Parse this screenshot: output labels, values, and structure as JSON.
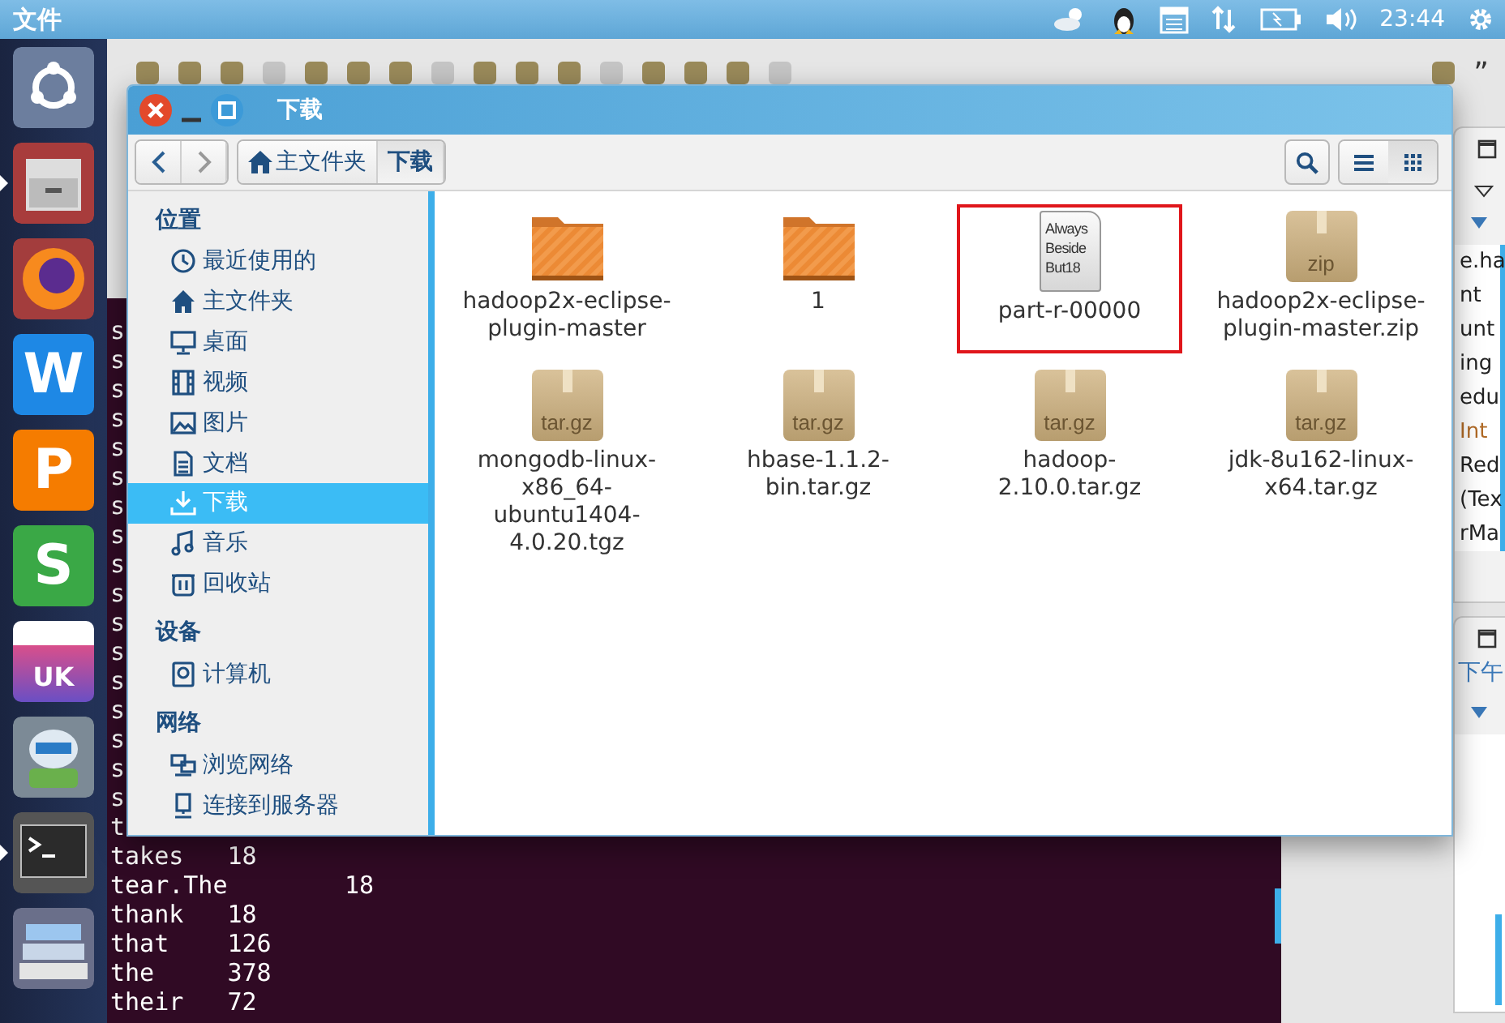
{
  "top_panel": {
    "menu": "文件",
    "clock": "23:44"
  },
  "launcher": [
    {
      "kind": "ubuntu",
      "selected": false
    },
    {
      "kind": "drawer",
      "selected": true
    },
    {
      "kind": "firefox",
      "selected": false
    },
    {
      "kind": "letter",
      "glyph": "W",
      "color": "#1e88e5",
      "selected": false
    },
    {
      "kind": "letter",
      "glyph": "P",
      "color": "#f57c00",
      "selected": false
    },
    {
      "kind": "letter",
      "glyph": "S",
      "color": "#3aa846",
      "selected": false
    },
    {
      "kind": "store",
      "glyph": "UK",
      "selected": false
    },
    {
      "kind": "robot",
      "selected": false
    },
    {
      "kind": "terminal",
      "selected": true
    },
    {
      "kind": "stack",
      "selected": false
    }
  ],
  "eclipse": {
    "toolbar_overflow": "”",
    "terminal_lines": [
      {
        "word": "s"
      },
      {
        "word": "s"
      },
      {
        "word": "s"
      },
      {
        "word": "s"
      },
      {
        "word": "s"
      },
      {
        "word": "s"
      },
      {
        "word": "s"
      },
      {
        "word": "s"
      },
      {
        "word": "s"
      },
      {
        "word": "s"
      },
      {
        "word": "s"
      },
      {
        "word": "s"
      },
      {
        "word": "s"
      },
      {
        "word": "s"
      },
      {
        "word": "s"
      },
      {
        "word": "s"
      },
      {
        "word": "s"
      },
      {
        "word": "t"
      },
      {
        "word": "takes",
        "count": "18"
      },
      {
        "word": "tear.The",
        "count": "18"
      },
      {
        "word": "thank",
        "count": "18"
      },
      {
        "word": "that",
        "count": "126"
      },
      {
        "word": "the",
        "count": "378"
      },
      {
        "word": "their",
        "count": "72"
      }
    ],
    "outline_items": [
      {
        "text": "e.ha",
        "kind": "plain"
      },
      {
        "text": "nt",
        "kind": "plain"
      },
      {
        "text": "unt",
        "kind": "plain"
      },
      {
        "text": "ing",
        "kind": "plain"
      },
      {
        "text": "edu",
        "kind": "plain"
      },
      {
        "text": "Int",
        "kind": "type"
      },
      {
        "text": "Red",
        "kind": "plain"
      },
      {
        "text": "(Tex",
        "kind": "plain"
      },
      {
        "text": "rMa",
        "kind": "plain"
      }
    ],
    "lower_panel_label": "下午"
  },
  "file_manager": {
    "title": "下载",
    "breadcrumbs": [
      {
        "label": "主文件夹",
        "kind": "home",
        "selected": false
      },
      {
        "label": "下载",
        "kind": "plain",
        "selected": true
      }
    ],
    "view_modes": [
      {
        "kind": "list",
        "selected": false
      },
      {
        "kind": "grid",
        "selected": true
      }
    ],
    "sidebar": [
      {
        "heading": "位置",
        "items": [
          {
            "label": "最近使用的",
            "selected": false
          },
          {
            "label": "主文件夹",
            "selected": false
          },
          {
            "label": "桌面",
            "selected": false
          },
          {
            "label": "视频",
            "selected": false
          },
          {
            "label": "图片",
            "selected": false
          },
          {
            "label": "文档",
            "selected": false
          },
          {
            "label": "下载",
            "selected": true
          },
          {
            "label": "音乐",
            "selected": false
          },
          {
            "label": "回收站",
            "selected": false
          }
        ]
      },
      {
        "heading": "设备",
        "items": [
          {
            "label": "计算机",
            "selected": false
          }
        ]
      },
      {
        "heading": "网络",
        "items": [
          {
            "label": "浏览网络",
            "selected": false
          },
          {
            "label": "连接到服务器",
            "selected": false
          }
        ]
      }
    ],
    "files": [
      {
        "name": "hadoop2x-eclipse-plugin-master",
        "kind": "folder",
        "highlighted": false
      },
      {
        "name": "1",
        "kind": "folder",
        "highlighted": false
      },
      {
        "name": "part-r-00000",
        "kind": "text",
        "preview": [
          "Always",
          "Beside",
          "But18"
        ],
        "highlighted": true
      },
      {
        "name": "hadoop2x-eclipse-plugin-master.zip",
        "kind": "archive",
        "badge": "zip",
        "highlighted": false
      },
      {
        "name": "mongodb-linux-x86_64-ubuntu1404-4.0.20.tgz",
        "kind": "archive",
        "badge": "tar.gz",
        "highlighted": false
      },
      {
        "name": "hbase-1.1.2-bin.tar.gz",
        "kind": "archive",
        "badge": "tar.gz",
        "highlighted": false
      },
      {
        "name": "hadoop-2.10.0.tar.gz",
        "kind": "archive",
        "badge": "tar.gz",
        "highlighted": false
      },
      {
        "name": "jdk-8u162-linux-x64.tar.gz",
        "kind": "archive",
        "badge": "tar.gz",
        "highlighted": false
      }
    ]
  }
}
